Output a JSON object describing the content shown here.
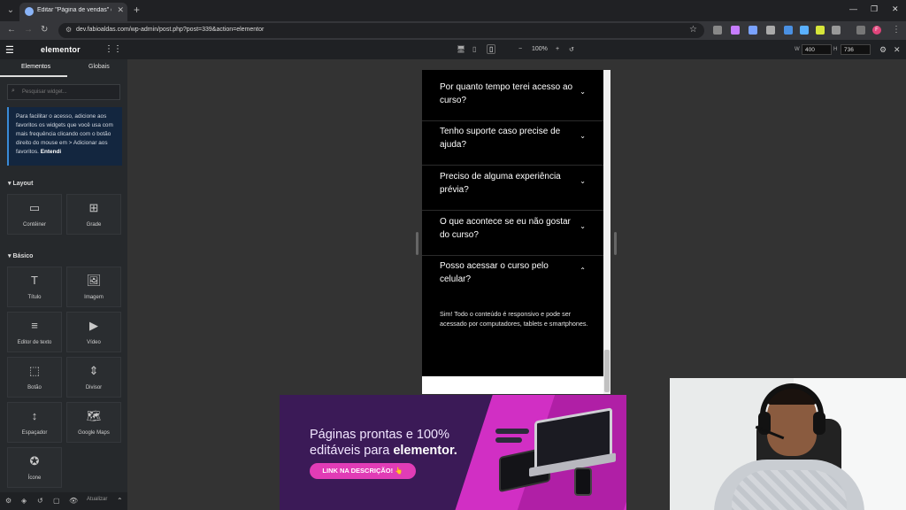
{
  "browser": {
    "tab_title": "Editar \"Página de vendas\" com",
    "url": "dev.fabioaldas.com/wp-admin/post.php?post=339&action=elementor",
    "profile_initial": "F"
  },
  "editor": {
    "logo": "elementor",
    "tabs": [
      "Elementos",
      "Globais"
    ],
    "search_placeholder": "Pesquisar widget...",
    "tip_text": "Para facilitar o acesso, adicione aos favoritos os widgets que você usa com mais frequência clicando com o botão direito do mouse em > Adicionar aos favoritos.",
    "tip_link": "Entendi",
    "sections": {
      "layout": "Layout",
      "basic": "Básico"
    },
    "layout_widgets": [
      "Contêiner",
      "Grade"
    ],
    "basic_widgets": [
      "Título",
      "Imagem",
      "Editor de texto",
      "Vídeo",
      "Botão",
      "Divisor",
      "Espaçador",
      "Google Maps",
      "Ícone"
    ],
    "update_label": "Atualizar"
  },
  "toolbar": {
    "zoom": "100%",
    "width_label": "W",
    "width": "400",
    "height_label": "H",
    "height": "736"
  },
  "faq": {
    "items": [
      {
        "q": "Por quanto tempo terei acesso ao curso?"
      },
      {
        "q": "Tenho suporte caso precise de ajuda?"
      },
      {
        "q": "Preciso de alguma experiência prévia?"
      },
      {
        "q": "O que acontece se eu não gostar do curso?"
      },
      {
        "q": "Posso acessar o curso pelo celular?"
      }
    ],
    "answer": "Sim! Todo o conteúdo é responsivo e pode ser acessado por computadores, tablets e smartphones."
  },
  "banner": {
    "line1": "Páginas prontas e 100%",
    "line2": "editáveis para",
    "brand": "elementor.",
    "cta": "LINK NA DESCRIÇÃO! 👆"
  },
  "colors": {
    "banner_bg": "#3b1a57",
    "banner_accent": "#d12fc4",
    "cta": "#e13cb6",
    "tip_bg": "#13263f"
  }
}
